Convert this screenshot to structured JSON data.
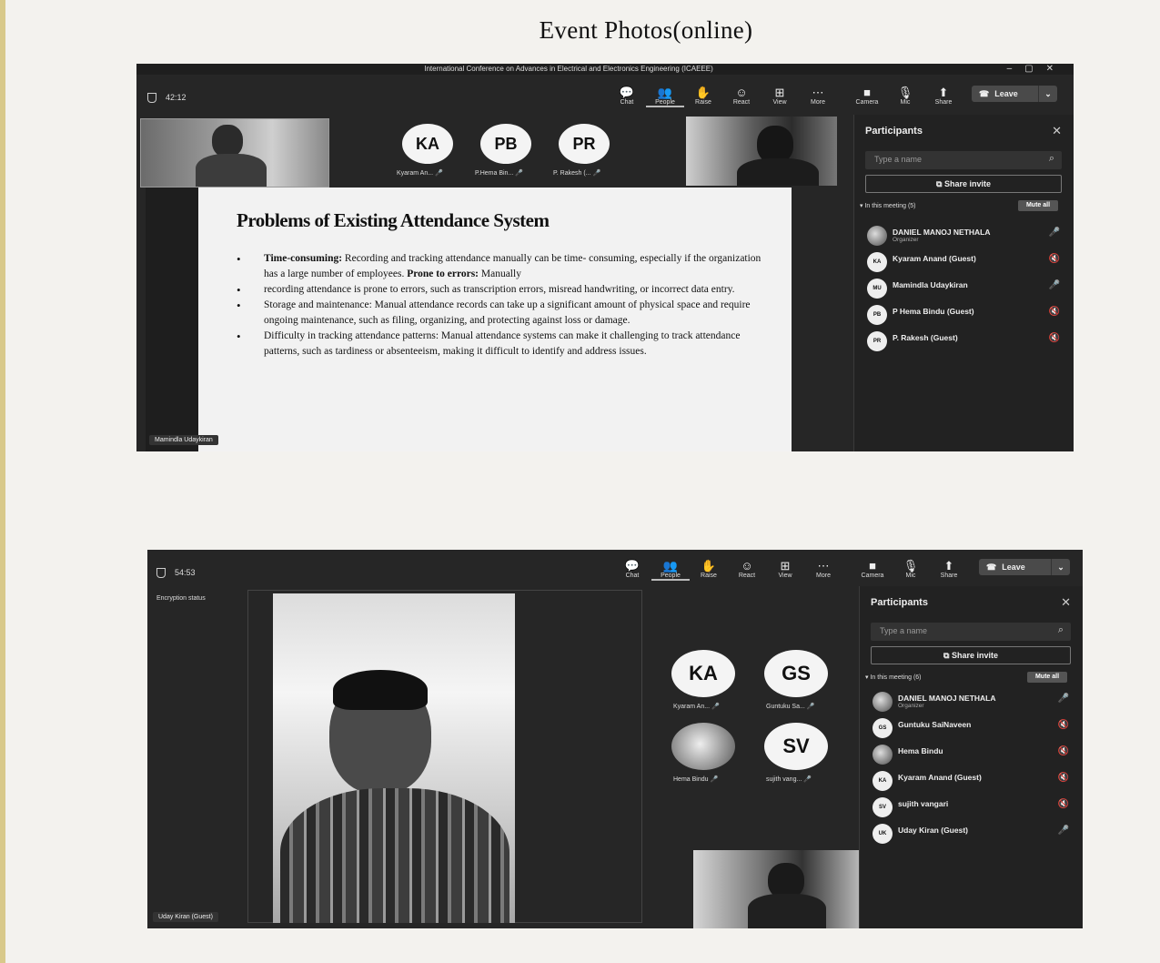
{
  "document": {
    "title": "Event Photos(online)"
  },
  "shot1": {
    "window_title": "International Conference on Advances in Electrical and Electronics Engineering (ICAEEE)",
    "timer": "42:12",
    "toolbar": [
      {
        "label": "Chat",
        "icon": "chat-icon",
        "glyph": "💬"
      },
      {
        "label": "People",
        "icon": "people-icon",
        "glyph": "👥"
      },
      {
        "label": "Raise",
        "icon": "raise-hand-icon",
        "glyph": "✋"
      },
      {
        "label": "React",
        "icon": "react-icon",
        "glyph": "☺"
      },
      {
        "label": "View",
        "icon": "view-icon",
        "glyph": "⊞"
      },
      {
        "label": "More",
        "icon": "more-icon",
        "glyph": "⋯"
      },
      {
        "label": "Camera",
        "icon": "camera-icon",
        "glyph": "■"
      },
      {
        "label": "Mic",
        "icon": "mic-icon",
        "glyph": "🎙"
      },
      {
        "label": "Share",
        "icon": "share-icon",
        "glyph": "⬆"
      }
    ],
    "leave_label": "Leave",
    "avatars": [
      {
        "initials": "KA",
        "label": "Kyaram An..."
      },
      {
        "initials": "PB",
        "label": "P.Hema Bin..."
      },
      {
        "initials": "PR",
        "label": "P. Rakesh (..."
      }
    ],
    "slide": {
      "title": "Problems of Existing Attendance System",
      "bullets": [
        {
          "lead": "Time-consuming:",
          "text": " Recording and tracking attendance manually can be time- consuming, especially if the organization has a large number of employees. ",
          "lead2": "Prone to errors:",
          "text2": " Manually"
        },
        {
          "lead": "",
          "text": "recording attendance is prone to errors, such as transcription errors, misread handwriting, or incorrect data entry.",
          "lead2": "",
          "text2": ""
        },
        {
          "lead": "",
          "text": "Storage and maintenance: Manual attendance records can take up a significant amount of physical space and require ongoing maintenance, such as filing, organizing, and protecting against loss or damage.",
          "lead2": "",
          "text2": ""
        },
        {
          "lead": "",
          "text": "Difficulty in tracking attendance patterns: Manual attendance systems can make it challenging to track attendance patterns, such as tardiness or absenteeism, making it difficult to identify and address issues.",
          "lead2": "",
          "text2": ""
        }
      ]
    },
    "presenter_tag": "Mamindla Udaykiran",
    "panel": {
      "title": "Participants",
      "search_placeholder": "Type a name",
      "share_invite": "Share invite",
      "in_meeting": "In this meeting (5)",
      "mute_all": "Mute all",
      "participants": [
        {
          "initials": "",
          "name": "DANIEL MANOJ NETHALA",
          "role": "Organizer",
          "mic": "on"
        },
        {
          "initials": "KA",
          "name": "Kyaram Anand (Guest)",
          "role": "",
          "mic": "off"
        },
        {
          "initials": "MU",
          "name": "Mamindla Udaykiran",
          "role": "",
          "mic": "on"
        },
        {
          "initials": "PB",
          "name": "P Hema Bindu (Guest)",
          "role": "",
          "mic": "off"
        },
        {
          "initials": "PR",
          "name": "P. Rakesh (Guest)",
          "role": "",
          "mic": "off"
        }
      ]
    }
  },
  "shot2": {
    "timer": "54:53",
    "encryption": "Encryption status",
    "toolbar": [
      {
        "label": "Chat",
        "icon": "chat-icon",
        "glyph": "💬"
      },
      {
        "label": "People",
        "icon": "people-icon",
        "glyph": "👥"
      },
      {
        "label": "Raise",
        "icon": "raise-hand-icon",
        "glyph": "✋"
      },
      {
        "label": "React",
        "icon": "react-icon",
        "glyph": "☺"
      },
      {
        "label": "View",
        "icon": "view-icon",
        "glyph": "⊞"
      },
      {
        "label": "More",
        "icon": "more-icon",
        "glyph": "⋯"
      },
      {
        "label": "Camera",
        "icon": "camera-icon",
        "glyph": "■"
      },
      {
        "label": "Mic",
        "icon": "mic-icon",
        "glyph": "🎙"
      },
      {
        "label": "Share",
        "icon": "share-icon",
        "glyph": "⬆"
      }
    ],
    "leave_label": "Leave",
    "avatars": [
      {
        "initials": "KA",
        "label": "Kyaram An..."
      },
      {
        "initials": "GS",
        "label": "Guntuku Sa..."
      },
      {
        "initials": "",
        "label": "Hema Bindu"
      },
      {
        "initials": "SV",
        "label": "sujith vang..."
      }
    ],
    "video_tag": "Uday Kiran (Guest)",
    "panel": {
      "title": "Participants",
      "search_placeholder": "Type a name",
      "share_invite": "Share invite",
      "in_meeting": "In this meeting (6)",
      "mute_all": "Mute all",
      "participants": [
        {
          "initials": "",
          "name": "DANIEL MANOJ NETHALA",
          "role": "Organizer",
          "mic": "on"
        },
        {
          "initials": "GS",
          "name": "Guntuku SaiNaveen",
          "role": "",
          "mic": "off"
        },
        {
          "initials": "",
          "name": "Hema Bindu",
          "role": "",
          "mic": "off"
        },
        {
          "initials": "KA",
          "name": "Kyaram Anand (Guest)",
          "role": "",
          "mic": "off"
        },
        {
          "initials": "SV",
          "name": "sujith vangari",
          "role": "",
          "mic": "off"
        },
        {
          "initials": "UK",
          "name": "Uday Kiran (Guest)",
          "role": "",
          "mic": "on"
        }
      ]
    }
  }
}
